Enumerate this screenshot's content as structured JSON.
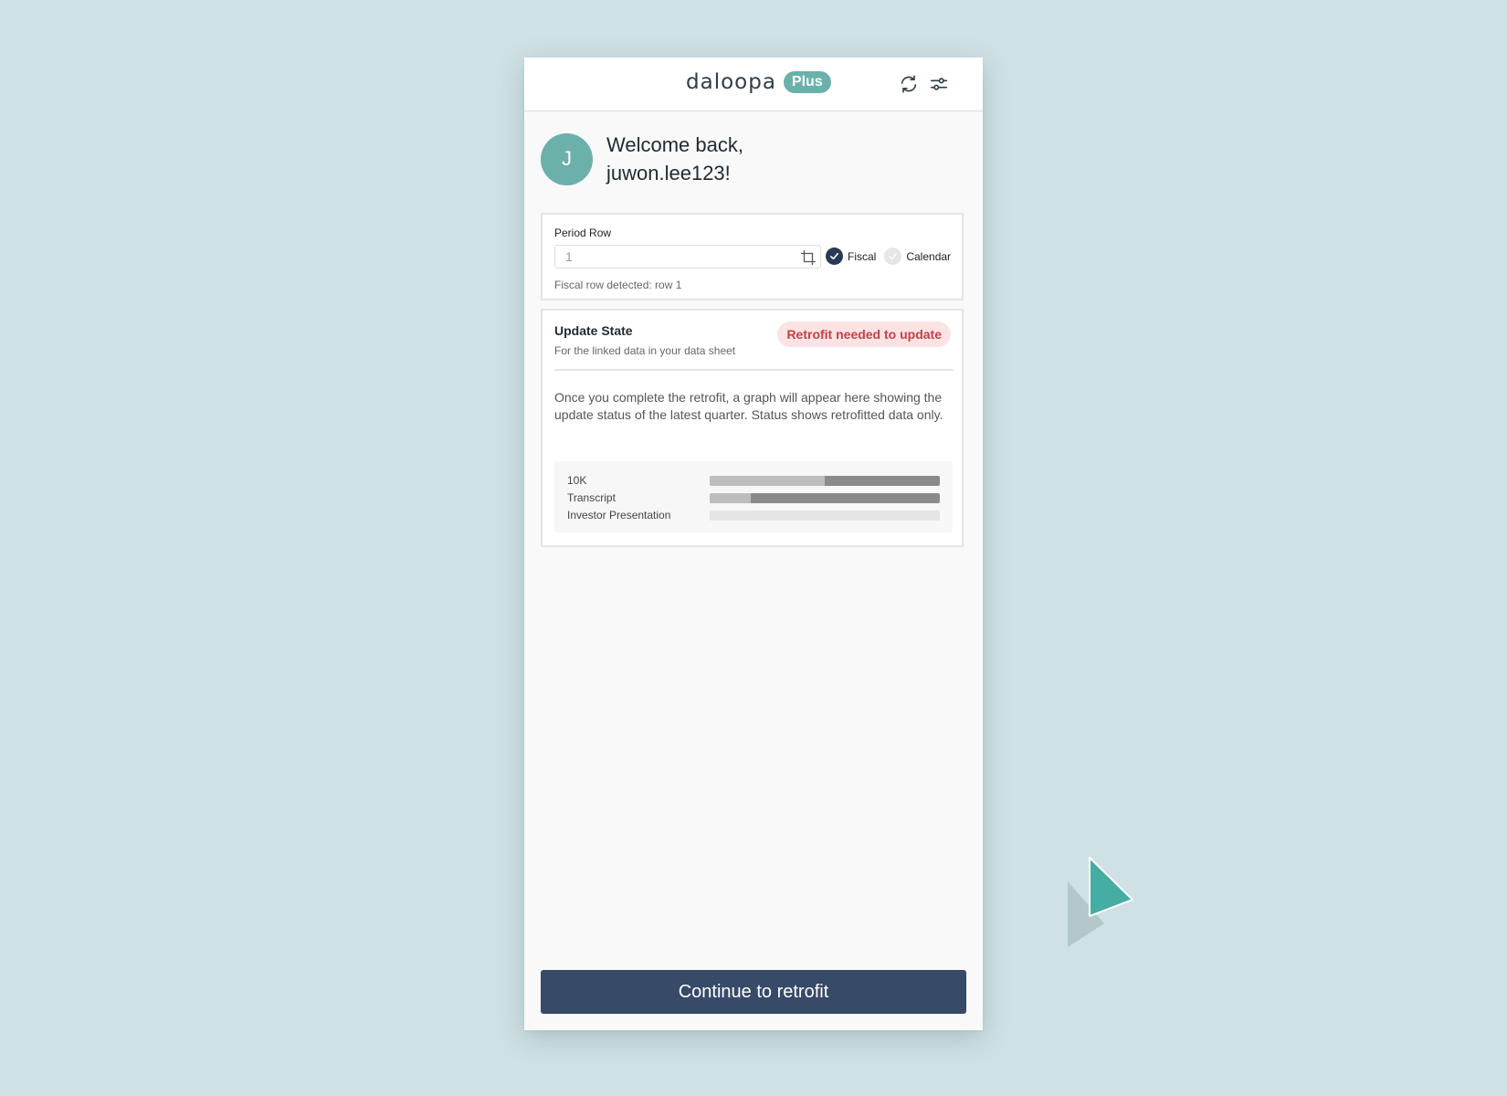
{
  "header": {
    "logo_text": "daloopa",
    "plan_badge": "Plus",
    "icons": [
      "refresh-icon",
      "settings-sliders-icon"
    ]
  },
  "welcome": {
    "avatar_initial": "J",
    "line1": "Welcome back,",
    "line2": "juwon.lee123!"
  },
  "period_row": {
    "label": "Period Row",
    "input_value": "1",
    "input_icon": "crop-icon",
    "options": [
      {
        "label": "Fiscal",
        "selected": true
      },
      {
        "label": "Calendar",
        "selected": false
      }
    ],
    "hint": "Fiscal row detected: row 1"
  },
  "update_state": {
    "title": "Update State",
    "subtitle": "For the linked data in your data sheet",
    "status": "Retrofit needed to update",
    "description": "Once you complete the retrofit, a graph will appear here showing the update status of the latest quarter. Status shows retrofitted data only.",
    "sources": [
      {
        "label": "10K",
        "light_fraction": 0.5,
        "dark_fraction": 0.5
      },
      {
        "label": "Transcript",
        "light_fraction": 0.18,
        "dark_fraction": 0.82
      },
      {
        "label": "Investor Presentation",
        "light_fraction": 0,
        "dark_fraction": 0
      }
    ]
  },
  "actions": {
    "continue_label": "Continue to retrofit"
  },
  "colors": {
    "accent_teal": "#6bb0ab",
    "primary_button": "#374a67",
    "status_text": "#c2404a",
    "status_bg": "#fbe3e3",
    "background": "#cfe1e4"
  }
}
